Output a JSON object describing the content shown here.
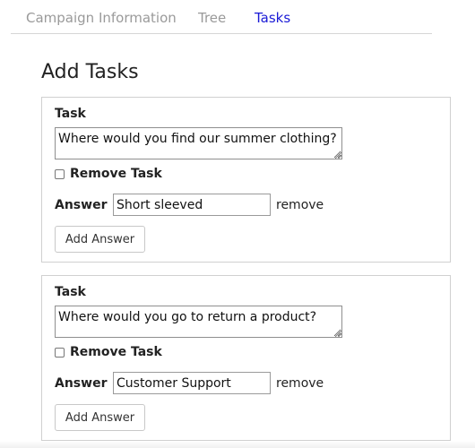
{
  "tabs": [
    {
      "label": "Campaign Information",
      "active": false
    },
    {
      "label": "Tree",
      "active": false
    },
    {
      "label": "Tasks",
      "active": true
    }
  ],
  "page_title": "Add Tasks",
  "tasks": [
    {
      "task_label": "Task",
      "task_text": "Where would you find our summer clothing?",
      "remove_task_label": "Remove Task",
      "remove_task_checked": false,
      "answer_label": "Answer",
      "answer_value": "Short sleeved",
      "remove_label": "remove",
      "add_answer_label": "Add Answer"
    },
    {
      "task_label": "Task",
      "task_text": "Where would you go to return a product?",
      "remove_task_label": "Remove Task",
      "remove_task_checked": false,
      "answer_label": "Answer",
      "answer_value": "Customer Support",
      "remove_label": "remove",
      "add_answer_label": "Add Answer"
    }
  ],
  "colors": {
    "active_tab": "#1a1ad6",
    "inactive_tab": "#9a9a9a",
    "card_border": "#d0d0d0"
  }
}
